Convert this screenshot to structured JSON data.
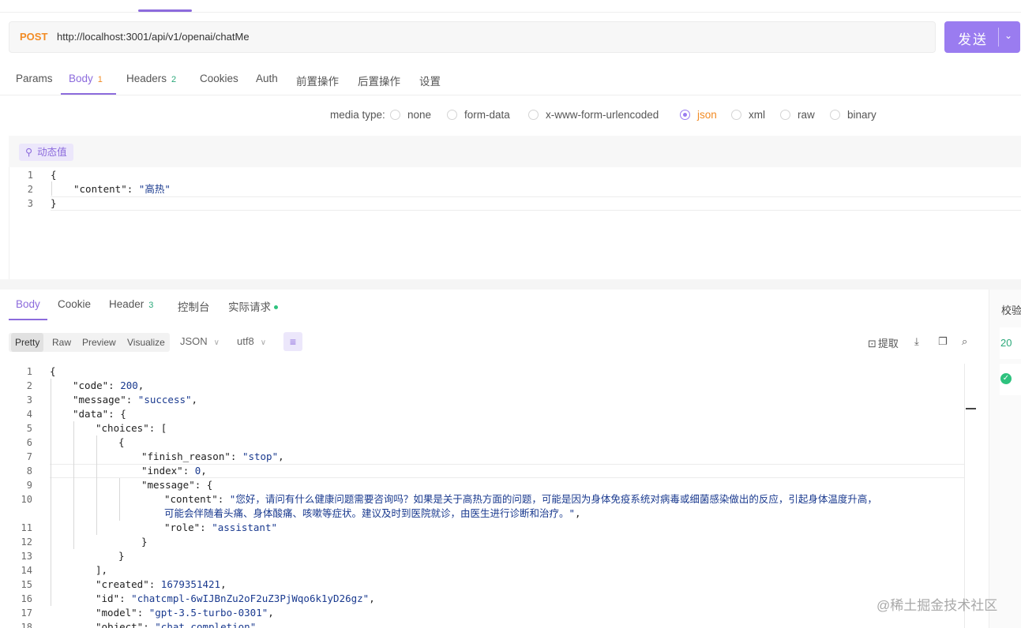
{
  "request": {
    "method": "POST",
    "url": "http://localhost:3001/api/v1/openai/chatMe",
    "send_label": "发送"
  },
  "request_tabs": [
    {
      "label": "Params",
      "count": ""
    },
    {
      "label": "Body",
      "count": "1"
    },
    {
      "label": "Headers",
      "count": "2"
    },
    {
      "label": "Cookies",
      "count": ""
    },
    {
      "label": "Auth",
      "count": ""
    },
    {
      "label": "前置操作",
      "count": ""
    },
    {
      "label": "后置操作",
      "count": ""
    },
    {
      "label": "设置",
      "count": ""
    }
  ],
  "media_type": {
    "label": "media type:",
    "options": [
      "none",
      "form-data",
      "x-www-form-urlencoded",
      "json",
      "xml",
      "raw",
      "binary"
    ],
    "selected": "json"
  },
  "dynamic_value_label": "动态值",
  "request_body_lines": [
    {
      "n": "1",
      "text": "{"
    },
    {
      "n": "2",
      "key": "\"content\"",
      "sep": ": ",
      "val": "\"高热\""
    },
    {
      "n": "3",
      "text": "}"
    }
  ],
  "response_tabs": [
    {
      "label": "Body",
      "count": ""
    },
    {
      "label": "Cookie",
      "count": ""
    },
    {
      "label": "Header",
      "count": "3"
    },
    {
      "label": "控制台",
      "count": ""
    },
    {
      "label": "实际请求",
      "count": ""
    }
  ],
  "right_panel": {
    "title": "校验",
    "status_code": "20"
  },
  "view_modes": [
    "Pretty",
    "Raw",
    "Preview",
    "Visualize"
  ],
  "format_select": "JSON",
  "encoding_select": "utf8",
  "extract_label": "提取",
  "response_lines": [
    {
      "n": "1",
      "indent": 0,
      "parts": [
        [
          "p",
          "{"
        ]
      ]
    },
    {
      "n": "2",
      "indent": 1,
      "parts": [
        [
          "k",
          "\"code\""
        ],
        [
          "p",
          ": "
        ],
        [
          "n",
          "200"
        ],
        [
          "p",
          ","
        ]
      ]
    },
    {
      "n": "3",
      "indent": 1,
      "parts": [
        [
          "k",
          "\"message\""
        ],
        [
          "p",
          ": "
        ],
        [
          "s",
          "\"success\""
        ],
        [
          "p",
          ","
        ]
      ]
    },
    {
      "n": "4",
      "indent": 1,
      "parts": [
        [
          "k",
          "\"data\""
        ],
        [
          "p",
          ": {"
        ]
      ]
    },
    {
      "n": "5",
      "indent": 2,
      "parts": [
        [
          "k",
          "\"choices\""
        ],
        [
          "p",
          ": ["
        ]
      ]
    },
    {
      "n": "6",
      "indent": 3,
      "parts": [
        [
          "p",
          "{"
        ]
      ]
    },
    {
      "n": "7",
      "indent": 4,
      "parts": [
        [
          "k",
          "\"finish_reason\""
        ],
        [
          "p",
          ": "
        ],
        [
          "s",
          "\"stop\""
        ],
        [
          "p",
          ","
        ]
      ]
    },
    {
      "n": "8",
      "indent": 4,
      "parts": [
        [
          "k",
          "\"index\""
        ],
        [
          "p",
          ": "
        ],
        [
          "n",
          "0"
        ],
        [
          "p",
          ","
        ]
      ]
    },
    {
      "n": "9",
      "indent": 4,
      "parts": [
        [
          "k",
          "\"message\""
        ],
        [
          "p",
          ": {"
        ]
      ]
    },
    {
      "n": "10",
      "indent": 5,
      "parts": [
        [
          "k",
          "\"content\""
        ],
        [
          "p",
          ": "
        ],
        [
          "s",
          "\"您好，请问有什么健康问题需要咨询吗？如果是关于高热方面的问题，可能是因为身体免疫系统对病毒或细菌感染做出的反应，引起身体温度升高，"
        ]
      ]
    },
    {
      "n": "",
      "indent": 5,
      "parts": [
        [
          "s",
          "可能会伴随着头痛、身体酸痛、咳嗽等症状。建议及时到医院就诊，由医生进行诊断和治疗。\""
        ],
        [
          "p",
          ","
        ]
      ]
    },
    {
      "n": "11",
      "indent": 5,
      "parts": [
        [
          "k",
          "\"role\""
        ],
        [
          "p",
          ": "
        ],
        [
          "s",
          "\"assistant\""
        ]
      ]
    },
    {
      "n": "12",
      "indent": 4,
      "parts": [
        [
          "p",
          "}"
        ]
      ]
    },
    {
      "n": "13",
      "indent": 3,
      "parts": [
        [
          "p",
          "}"
        ]
      ]
    },
    {
      "n": "14",
      "indent": 2,
      "parts": [
        [
          "p",
          "],"
        ]
      ]
    },
    {
      "n": "15",
      "indent": 2,
      "parts": [
        [
          "k",
          "\"created\""
        ],
        [
          "p",
          ": "
        ],
        [
          "n",
          "1679351421"
        ],
        [
          "p",
          ","
        ]
      ]
    },
    {
      "n": "16",
      "indent": 2,
      "parts": [
        [
          "k",
          "\"id\""
        ],
        [
          "p",
          ": "
        ],
        [
          "s",
          "\"chatcmpl-6wIJBnZu2oF2uZ3PjWqo6k1yD26gz\""
        ],
        [
          "p",
          ","
        ]
      ]
    },
    {
      "n": "17",
      "indent": 2,
      "parts": [
        [
          "k",
          "\"model\""
        ],
        [
          "p",
          ": "
        ],
        [
          "s",
          "\"gpt-3.5-turbo-0301\""
        ],
        [
          "p",
          ","
        ]
      ]
    },
    {
      "n": "18",
      "indent": 2,
      "parts": [
        [
          "k",
          "\"object\""
        ],
        [
          "p",
          ": "
        ],
        [
          "s",
          "\"chat.completion\""
        ]
      ]
    }
  ],
  "watermark": "@稀土掘金技术社区",
  "colors": {
    "accent": "#8c6bdc",
    "method": "#f28b24",
    "send": "#9a7cf0",
    "success": "#2ec27e"
  }
}
